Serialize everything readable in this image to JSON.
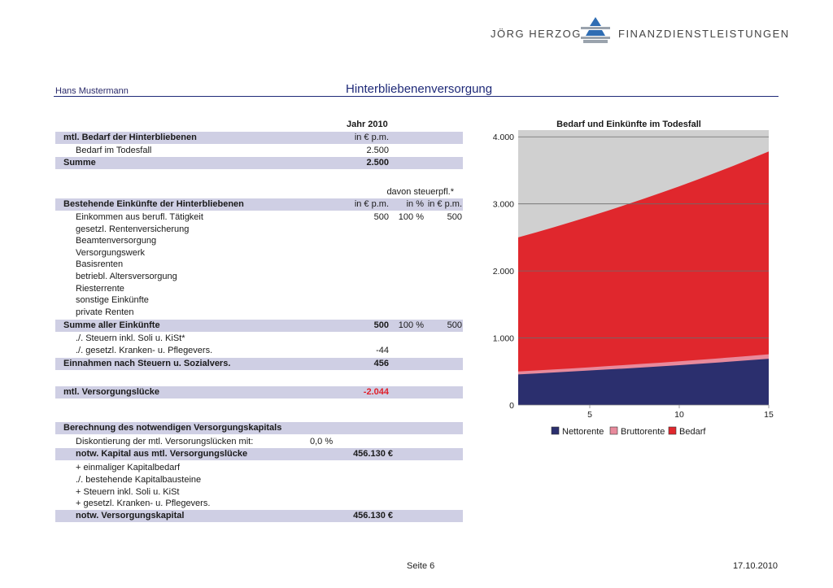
{
  "header": {
    "brand_left": "JÖRG HERZOG",
    "brand_right": "FINANZDIENSTLEISTUNGEN",
    "person": "Hans Mustermann",
    "title": "Hinterbliebenenversorgung"
  },
  "table": {
    "year_header": "Jahr 2010",
    "bedarf_header": "mtl. Bedarf der Hinterbliebenen",
    "unit": "in € p.m.",
    "bedarf_label": "Bedarf im Todesfall",
    "bedarf_value": "2.500",
    "summe_label": "Summe",
    "summe_value": "2.500",
    "davon_label": "davon steuerpfl.*",
    "einkuenfte_header": "Bestehende Einkünfte der Hinterbliebenen",
    "pct_unit": "in %",
    "income_rows": [
      {
        "label": "Einkommen aus berufl. Tätigkeit",
        "value": "500",
        "pct": "100 %",
        "taxable": "500"
      },
      {
        "label": "gesetzl. Rentenversicherung",
        "value": "",
        "pct": "",
        "taxable": ""
      },
      {
        "label": "Beamtenversorgung",
        "value": "",
        "pct": "",
        "taxable": ""
      },
      {
        "label": "Versorgungswerk",
        "value": "",
        "pct": "",
        "taxable": ""
      },
      {
        "label": "Basisrenten",
        "value": "",
        "pct": "",
        "taxable": ""
      },
      {
        "label": "betriebl. Altersversorgung",
        "value": "",
        "pct": "",
        "taxable": ""
      },
      {
        "label": "Riesterrente",
        "value": "",
        "pct": "",
        "taxable": ""
      },
      {
        "label": "sonstige Einkünfte",
        "value": "",
        "pct": "",
        "taxable": ""
      },
      {
        "label": "private Renten",
        "value": "",
        "pct": "",
        "taxable": ""
      }
    ],
    "summe_einkuenfte_label": "Summe aller Einkünfte",
    "summe_einkuenfte_value": "500",
    "summe_einkuenfte_pct": "100 %",
    "summe_einkuenfte_taxable": "500",
    "steuern_label": "./. Steuern inkl. Soli u. KiSt*",
    "steuern_value": "",
    "kv_label": "./. gesetzl. Kranken- u. Pflegevers.",
    "kv_value": "-44",
    "einnahmen_label": "Einnahmen nach Steuern u. Sozialvers.",
    "einnahmen_value": "456",
    "luecke_label": "mtl. Versorgungslücke",
    "luecke_value": "-2.044",
    "kapital_header": "Berechnung des notwendigen Versorgungskapitals",
    "diskont_label": "Diskontierung der mtl. Versorungslücken mit:",
    "diskont_value": "0,0 %",
    "notw_kapital_label": "notw. Kapital aus mtl. Versorgungslücke",
    "notw_kapital_value": "456.130 €",
    "extra_rows": [
      "+ einmaliger Kapitalbedarf",
      "./. bestehende Kapitalbausteine",
      "+ Steuern inkl. Soli u. KiSt",
      "+ gesetzl. Kranken- u. Pflegevers."
    ],
    "versorgungskapital_label": "notw. Versorgungskapital",
    "versorgungskapital_value": "456.130 €"
  },
  "chart_data": {
    "type": "area",
    "title": "Bedarf und Einkünfte im Todesfall",
    "x": [
      1,
      2,
      3,
      4,
      5,
      6,
      7,
      8,
      9,
      10,
      11,
      12,
      13,
      14,
      15
    ],
    "xticks": [
      "5",
      "10",
      "15"
    ],
    "xtick_values": [
      5,
      10,
      15
    ],
    "yticks": [
      "0",
      "1.000",
      "2.000",
      "3.000",
      "4.000"
    ],
    "ytick_values": [
      0,
      1000,
      2000,
      3000,
      4000
    ],
    "ylim": [
      0,
      4100
    ],
    "xlim": [
      1,
      15
    ],
    "grid": "horizontal",
    "legend_position": "bottom",
    "series": [
      {
        "name": "Nettorente",
        "color": "#2b2f6e",
        "values": [
          456,
          470,
          485,
          500,
          515,
          530,
          545,
          561,
          578,
          595,
          613,
          631,
          650,
          670,
          690
        ]
      },
      {
        "name": "Bruttorente",
        "color": "#e88a9c",
        "values": [
          500,
          515,
          530,
          546,
          563,
          580,
          597,
          615,
          633,
          652,
          672,
          692,
          713,
          734,
          756
        ]
      },
      {
        "name": "Bedarf",
        "color": "#e0272d",
        "values": [
          2500,
          2575,
          2652,
          2732,
          2814,
          2898,
          2985,
          3075,
          3167,
          3262,
          3360,
          3461,
          3565,
          3672,
          3782
        ]
      }
    ],
    "background_fill_color": "#d0d0d0"
  },
  "footer": {
    "page": "Seite 6",
    "date": "17.10.2010"
  }
}
